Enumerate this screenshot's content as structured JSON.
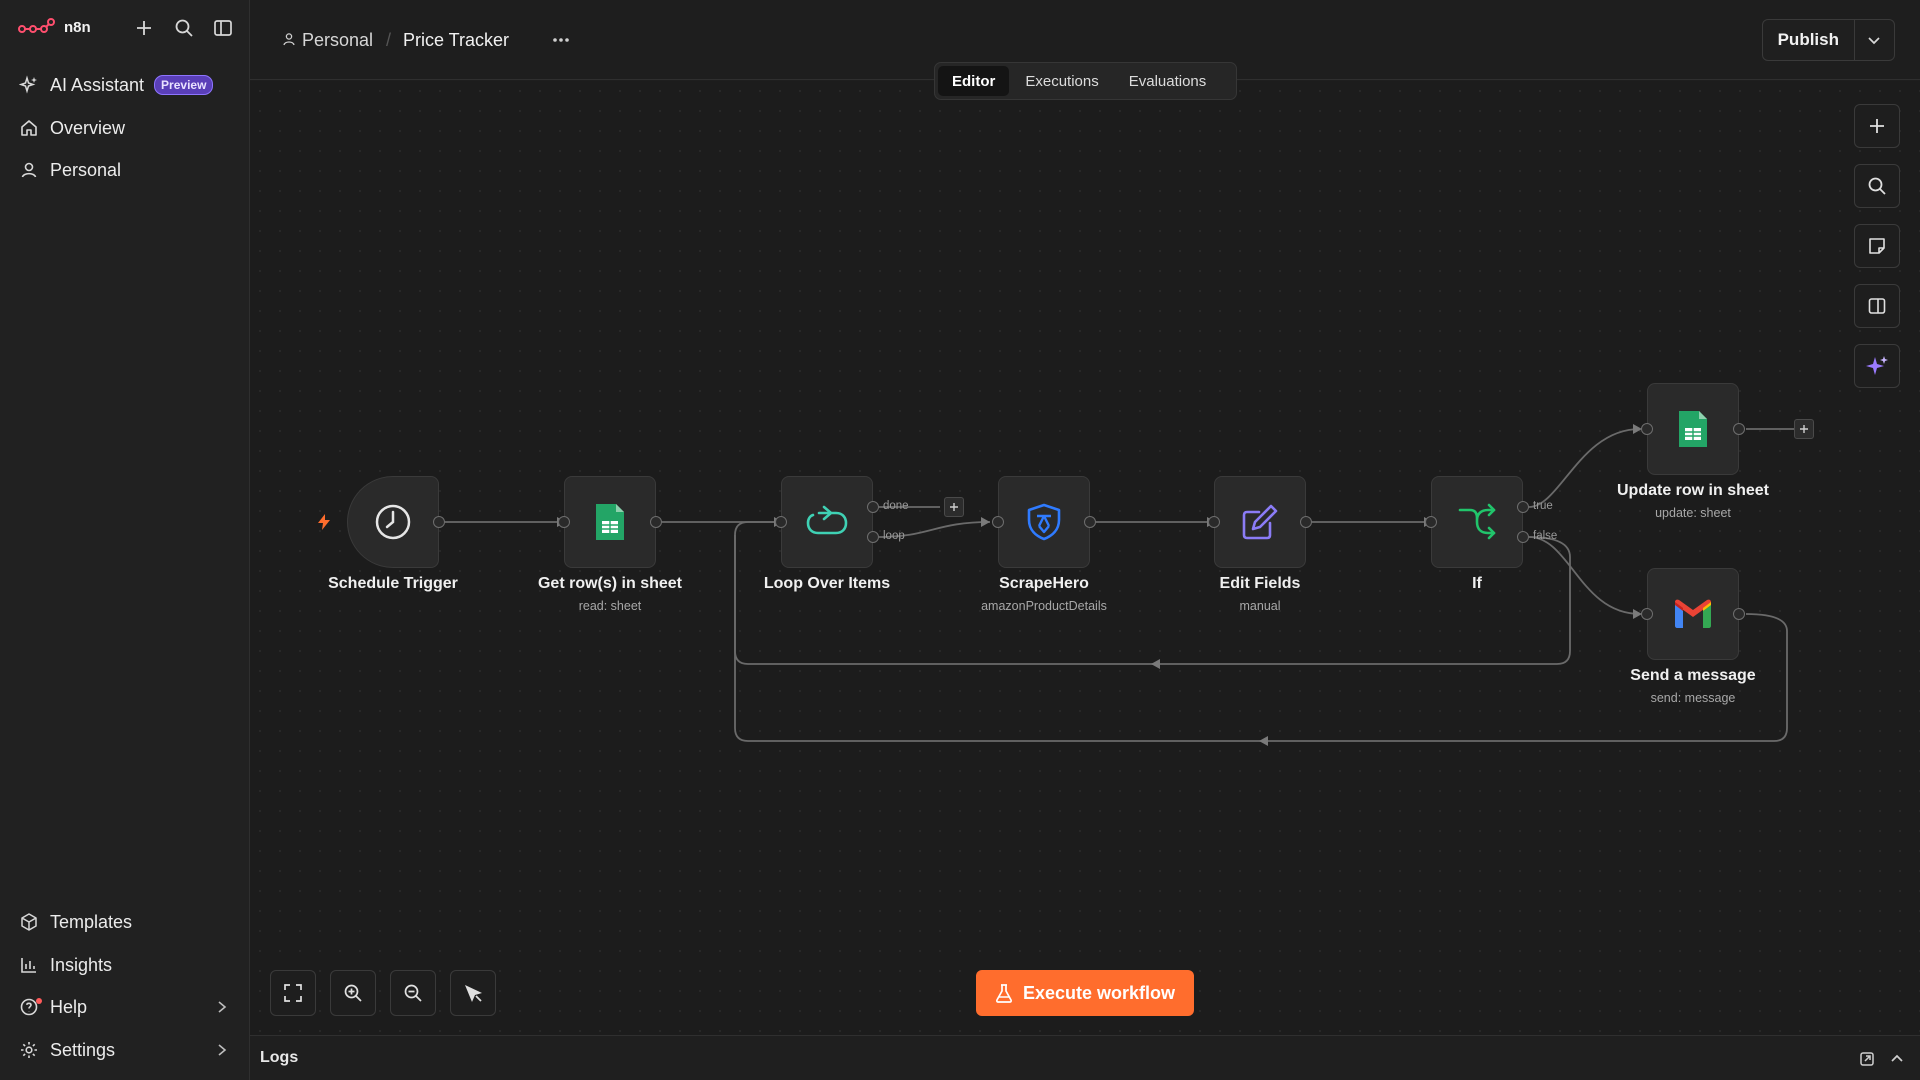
{
  "app": {
    "brand": "n8n"
  },
  "sidebar": {
    "top_items": [
      {
        "label": "AI Assistant",
        "badge": "Preview"
      },
      {
        "label": "Overview"
      },
      {
        "label": "Personal"
      }
    ],
    "bottom_items": [
      {
        "label": "Templates"
      },
      {
        "label": "Insights"
      },
      {
        "label": "Help"
      },
      {
        "label": "Settings"
      }
    ]
  },
  "header": {
    "project": "Personal",
    "title": "Price Tracker",
    "tabs": [
      {
        "label": "Editor",
        "active": true
      },
      {
        "label": "Executions",
        "active": false
      },
      {
        "label": "Evaluations",
        "active": false
      }
    ],
    "publish_label": "Publish"
  },
  "workflow": {
    "nodes": [
      {
        "id": "schedule",
        "label": "Schedule Trigger",
        "subtitle": ""
      },
      {
        "id": "getrows",
        "label": "Get row(s) in sheet",
        "subtitle": "read: sheet"
      },
      {
        "id": "loop",
        "label": "Loop Over Items",
        "subtitle": "",
        "outputs": [
          "done",
          "loop"
        ]
      },
      {
        "id": "scrape",
        "label": "ScrapeHero",
        "subtitle": "amazonProductDetails"
      },
      {
        "id": "edit",
        "label": "Edit Fields",
        "subtitle": "manual"
      },
      {
        "id": "if",
        "label": "If",
        "subtitle": "",
        "outputs": [
          "true",
          "false"
        ]
      },
      {
        "id": "update",
        "label": "Update row in sheet",
        "subtitle": "update: sheet"
      },
      {
        "id": "gmail",
        "label": "Send a message",
        "subtitle": "send: message"
      }
    ]
  },
  "canvas": {
    "execute_label": "Execute workflow"
  },
  "logs": {
    "title": "Logs"
  },
  "colors": {
    "accent": "#ff6d2d",
    "sheets_green": "#23a566",
    "loop_teal": "#3fd1b4",
    "scrapehero_blue": "#2f7bff",
    "edit_purple": "#8b7cf6",
    "if_green": "#21c46b",
    "ai_purple": "#9b7bff"
  }
}
